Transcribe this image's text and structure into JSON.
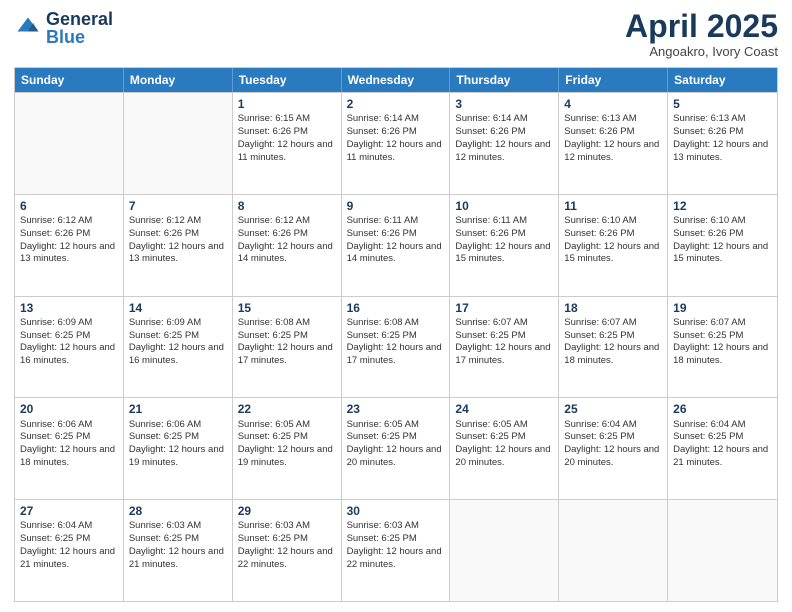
{
  "header": {
    "logo_general": "General",
    "logo_blue": "Blue",
    "title": "April 2025",
    "location": "Angoakro, Ivory Coast"
  },
  "calendar": {
    "days_of_week": [
      "Sunday",
      "Monday",
      "Tuesday",
      "Wednesday",
      "Thursday",
      "Friday",
      "Saturday"
    ],
    "weeks": [
      [
        {
          "day": "",
          "info": ""
        },
        {
          "day": "",
          "info": ""
        },
        {
          "day": "1",
          "info": "Sunrise: 6:15 AM\nSunset: 6:26 PM\nDaylight: 12 hours and 11 minutes."
        },
        {
          "day": "2",
          "info": "Sunrise: 6:14 AM\nSunset: 6:26 PM\nDaylight: 12 hours and 11 minutes."
        },
        {
          "day": "3",
          "info": "Sunrise: 6:14 AM\nSunset: 6:26 PM\nDaylight: 12 hours and 12 minutes."
        },
        {
          "day": "4",
          "info": "Sunrise: 6:13 AM\nSunset: 6:26 PM\nDaylight: 12 hours and 12 minutes."
        },
        {
          "day": "5",
          "info": "Sunrise: 6:13 AM\nSunset: 6:26 PM\nDaylight: 12 hours and 13 minutes."
        }
      ],
      [
        {
          "day": "6",
          "info": "Sunrise: 6:12 AM\nSunset: 6:26 PM\nDaylight: 12 hours and 13 minutes."
        },
        {
          "day": "7",
          "info": "Sunrise: 6:12 AM\nSunset: 6:26 PM\nDaylight: 12 hours and 13 minutes."
        },
        {
          "day": "8",
          "info": "Sunrise: 6:12 AM\nSunset: 6:26 PM\nDaylight: 12 hours and 14 minutes."
        },
        {
          "day": "9",
          "info": "Sunrise: 6:11 AM\nSunset: 6:26 PM\nDaylight: 12 hours and 14 minutes."
        },
        {
          "day": "10",
          "info": "Sunrise: 6:11 AM\nSunset: 6:26 PM\nDaylight: 12 hours and 15 minutes."
        },
        {
          "day": "11",
          "info": "Sunrise: 6:10 AM\nSunset: 6:26 PM\nDaylight: 12 hours and 15 minutes."
        },
        {
          "day": "12",
          "info": "Sunrise: 6:10 AM\nSunset: 6:26 PM\nDaylight: 12 hours and 15 minutes."
        }
      ],
      [
        {
          "day": "13",
          "info": "Sunrise: 6:09 AM\nSunset: 6:25 PM\nDaylight: 12 hours and 16 minutes."
        },
        {
          "day": "14",
          "info": "Sunrise: 6:09 AM\nSunset: 6:25 PM\nDaylight: 12 hours and 16 minutes."
        },
        {
          "day": "15",
          "info": "Sunrise: 6:08 AM\nSunset: 6:25 PM\nDaylight: 12 hours and 17 minutes."
        },
        {
          "day": "16",
          "info": "Sunrise: 6:08 AM\nSunset: 6:25 PM\nDaylight: 12 hours and 17 minutes."
        },
        {
          "day": "17",
          "info": "Sunrise: 6:07 AM\nSunset: 6:25 PM\nDaylight: 12 hours and 17 minutes."
        },
        {
          "day": "18",
          "info": "Sunrise: 6:07 AM\nSunset: 6:25 PM\nDaylight: 12 hours and 18 minutes."
        },
        {
          "day": "19",
          "info": "Sunrise: 6:07 AM\nSunset: 6:25 PM\nDaylight: 12 hours and 18 minutes."
        }
      ],
      [
        {
          "day": "20",
          "info": "Sunrise: 6:06 AM\nSunset: 6:25 PM\nDaylight: 12 hours and 18 minutes."
        },
        {
          "day": "21",
          "info": "Sunrise: 6:06 AM\nSunset: 6:25 PM\nDaylight: 12 hours and 19 minutes."
        },
        {
          "day": "22",
          "info": "Sunrise: 6:05 AM\nSunset: 6:25 PM\nDaylight: 12 hours and 19 minutes."
        },
        {
          "day": "23",
          "info": "Sunrise: 6:05 AM\nSunset: 6:25 PM\nDaylight: 12 hours and 20 minutes."
        },
        {
          "day": "24",
          "info": "Sunrise: 6:05 AM\nSunset: 6:25 PM\nDaylight: 12 hours and 20 minutes."
        },
        {
          "day": "25",
          "info": "Sunrise: 6:04 AM\nSunset: 6:25 PM\nDaylight: 12 hours and 20 minutes."
        },
        {
          "day": "26",
          "info": "Sunrise: 6:04 AM\nSunset: 6:25 PM\nDaylight: 12 hours and 21 minutes."
        }
      ],
      [
        {
          "day": "27",
          "info": "Sunrise: 6:04 AM\nSunset: 6:25 PM\nDaylight: 12 hours and 21 minutes."
        },
        {
          "day": "28",
          "info": "Sunrise: 6:03 AM\nSunset: 6:25 PM\nDaylight: 12 hours and 21 minutes."
        },
        {
          "day": "29",
          "info": "Sunrise: 6:03 AM\nSunset: 6:25 PM\nDaylight: 12 hours and 22 minutes."
        },
        {
          "day": "30",
          "info": "Sunrise: 6:03 AM\nSunset: 6:25 PM\nDaylight: 12 hours and 22 minutes."
        },
        {
          "day": "",
          "info": ""
        },
        {
          "day": "",
          "info": ""
        },
        {
          "day": "",
          "info": ""
        }
      ]
    ]
  }
}
